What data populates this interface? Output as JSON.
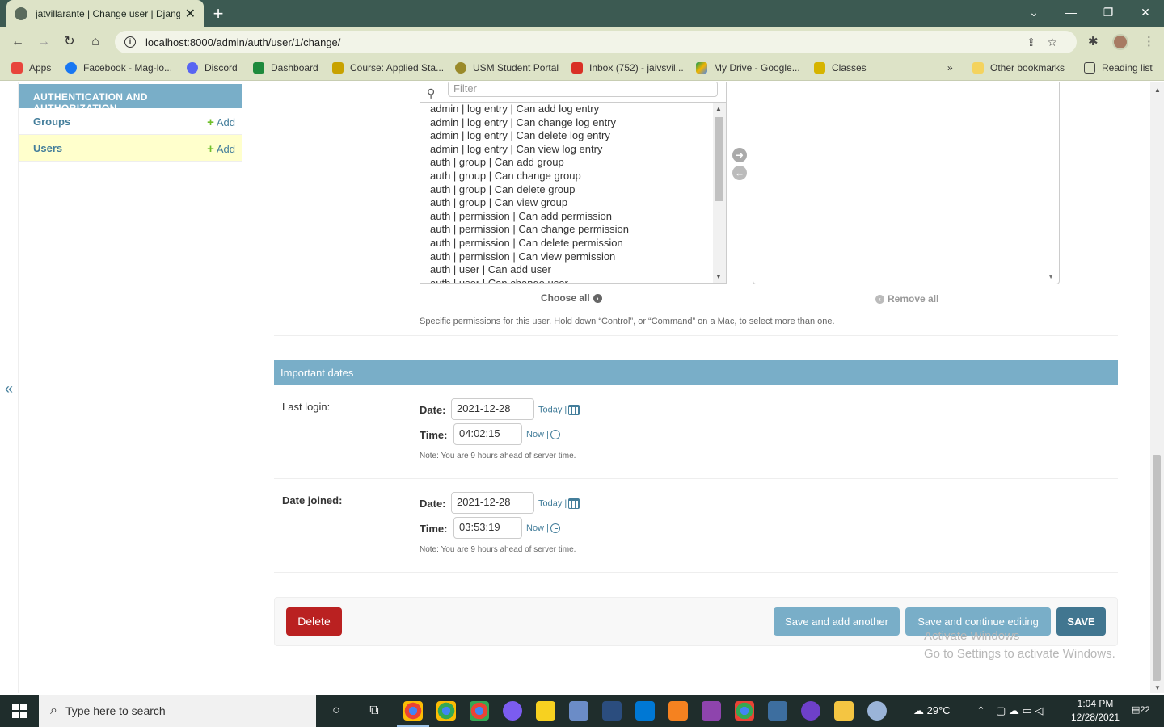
{
  "browser": {
    "tab_title": "jatvillarante | Change user | Djang",
    "url": "localhost:8000/admin/auth/user/1/change/",
    "bookmarks": [
      {
        "label": "Apps",
        "color": "#e8453c"
      },
      {
        "label": "Facebook - Mag-lo...",
        "color": "#1877f2"
      },
      {
        "label": "Discord",
        "color": "#5865f2"
      },
      {
        "label": "Dashboard",
        "color": "#1e8a3c"
      },
      {
        "label": "Course: Applied Sta...",
        "color": "#c8a200"
      },
      {
        "label": "USM Student Portal",
        "color": "#9a8a2a"
      },
      {
        "label": "Inbox (752) - jaivsvil...",
        "color": "#d93025"
      },
      {
        "label": "My Drive - Google...",
        "color": "#f4b400"
      },
      {
        "label": "Classes",
        "color": "#d6b400"
      }
    ],
    "overflow": "»",
    "other_bookmarks": "Other bookmarks",
    "reading_list": "Reading list"
  },
  "sidebar": {
    "collapse_label": "«",
    "module_caption": "AUTHENTICATION AND AUTHORIZATION",
    "items": [
      {
        "name": "Groups",
        "add": "Add"
      },
      {
        "name": "Users",
        "add": "Add"
      }
    ]
  },
  "permissions": {
    "filter_placeholder": "Filter",
    "available": [
      "admin | log entry | Can add log entry",
      "admin | log entry | Can change log entry",
      "admin | log entry | Can delete log entry",
      "admin | log entry | Can view log entry",
      "auth | group | Can add group",
      "auth | group | Can change group",
      "auth | group | Can delete group",
      "auth | group | Can view group",
      "auth | permission | Can add permission",
      "auth | permission | Can change permission",
      "auth | permission | Can delete permission",
      "auth | permission | Can view permission",
      "auth | user | Can add user",
      "auth | user | Can change user"
    ],
    "choose_all": "Choose all",
    "remove_all": "Remove all",
    "help": "Specific permissions for this user. Hold down “Control”, or “Command” on a Mac, to select more than one."
  },
  "important_dates": {
    "caption": "Important dates",
    "last_login": {
      "label": "Last login:",
      "date_label": "Date:",
      "date": "2021-12-28",
      "today": "Today |",
      "time_label": "Time:",
      "time": "04:02:15",
      "now": "Now |",
      "note": "Note: You are 9 hours ahead of server time."
    },
    "date_joined": {
      "label": "Date joined:",
      "date_label": "Date:",
      "date": "2021-12-28",
      "today": "Today |",
      "time_label": "Time:",
      "time": "03:53:19",
      "now": "Now |",
      "note": "Note: You are 9 hours ahead of server time."
    }
  },
  "submit": {
    "delete": "Delete",
    "save_add_another": "Save and add another",
    "save_continue": "Save and continue editing",
    "save": "SAVE"
  },
  "watermark": {
    "line1": "Activate Windows",
    "line2": "Go to Settings to activate Windows."
  },
  "taskbar": {
    "search_placeholder": "Type here to search",
    "weather": "29°C",
    "time": "1:04 PM",
    "date": "12/28/2021",
    "notifications": "22"
  }
}
